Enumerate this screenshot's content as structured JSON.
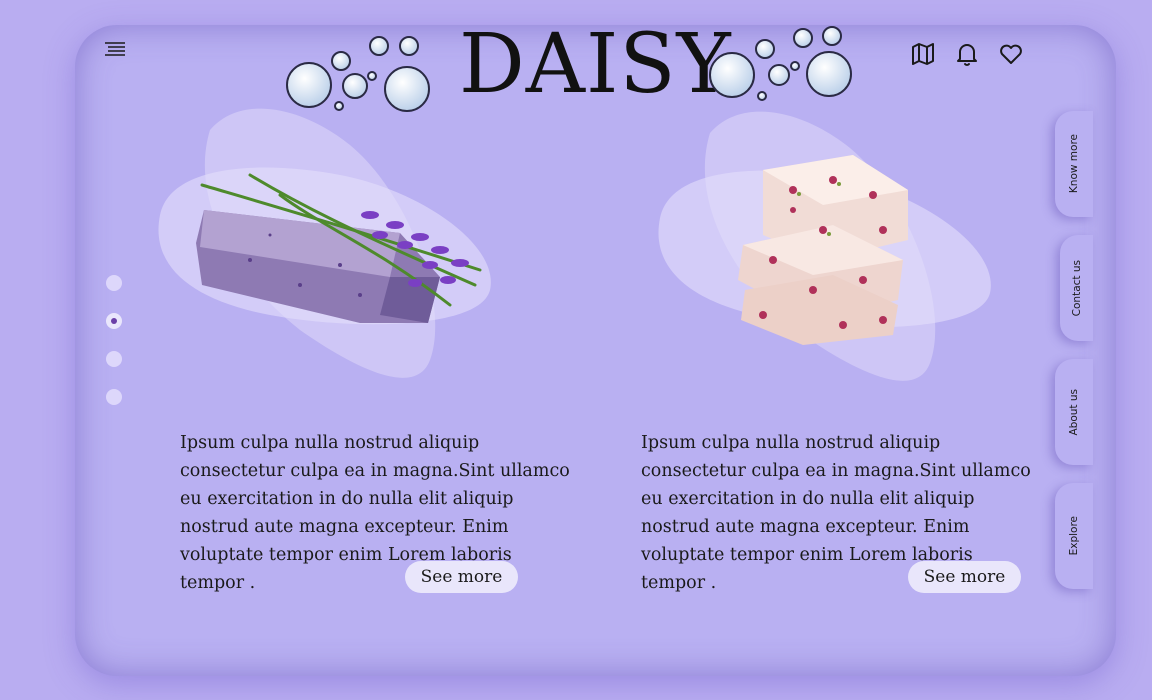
{
  "brand": {
    "name": "DAISY"
  },
  "header": {
    "menu_icon": "menu-lines-icon",
    "icons": [
      "map-icon",
      "bell-icon",
      "heart-icon"
    ]
  },
  "carousel": {
    "dots": 4,
    "active_index": 1
  },
  "products": [
    {
      "image": "lavender-soap-image",
      "description": "Ipsum culpa nulla nostrud aliquip consectetur culpa ea in magna.Sint ullamco eu exercitation in do nulla elit aliquip nostrud aute magna excepteur. Enim voluptate tempor enim Lorem laboris tempor .",
      "button": "See more"
    },
    {
      "image": "rose-soap-image",
      "description": "Ipsum culpa nulla nostrud aliquip consectetur culpa ea in magna.Sint ullamco eu exercitation in do nulla elit aliquip nostrud aute magna excepteur. Enim voluptate tempor enim Lorem laboris tempor .",
      "button": "See more"
    }
  ],
  "side_nav": [
    "Know more",
    "Contact us",
    "About us",
    "Explore"
  ],
  "colors": {
    "background": "#b9adf1",
    "card": "#b9b0f2",
    "button": "#e9e6fb",
    "accent": "#6b3fa8"
  }
}
